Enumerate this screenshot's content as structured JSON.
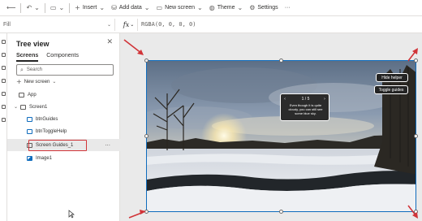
{
  "toolbar": {
    "back_icon": "back-arrow-icon",
    "undo_icon": "undo-icon",
    "insert_label": "Insert",
    "add_data_label": "Add data",
    "new_screen_label": "New screen",
    "theme_label": "Theme",
    "settings_label": "Settings",
    "more_label": "···"
  },
  "formula_bar": {
    "property": "Fill",
    "fx_label": "fx",
    "formula": "RGBA(0, 0, 0, 0)"
  },
  "tree_view": {
    "title": "Tree view",
    "close": "✕",
    "tabs": [
      "Screens",
      "Components"
    ],
    "search_placeholder": "Search",
    "new_screen_label": "New screen",
    "items": [
      {
        "label": "App"
      },
      {
        "label": "Screen1"
      },
      {
        "label": "btnGuides"
      },
      {
        "label": "btnToggleHelp"
      },
      {
        "label": "Screen Guides_1"
      },
      {
        "label": "Image1"
      }
    ],
    "more": "···"
  },
  "canvas": {
    "hide_helper_label": "Hide helper",
    "toggle_guides_label": "Toggle guides",
    "callout": {
      "pager": "1 / 5",
      "prev": "‹",
      "next": "›",
      "message": "Even though it is quite cloudy, you can still see some blue sky."
    }
  },
  "colors": {
    "accent": "#0f6cbd",
    "annotation_red": "#d13438"
  }
}
